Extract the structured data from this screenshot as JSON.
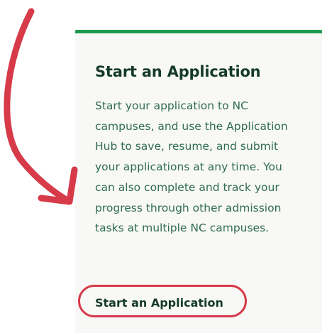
{
  "card": {
    "title": "Start an Application",
    "body": "Start your application to NC campuses, and use the Application Hub to save, resume, and submit your applications at any time. You can also complete and track your progress through other admission tasks at multiple NC campuses.",
    "link_label": "Start an Application",
    "accent_color": "#1d9a50"
  },
  "annotation": {
    "color": "#d73a49",
    "arrow_icon": "curved-arrow-icon",
    "highlight": "circle-highlight"
  }
}
